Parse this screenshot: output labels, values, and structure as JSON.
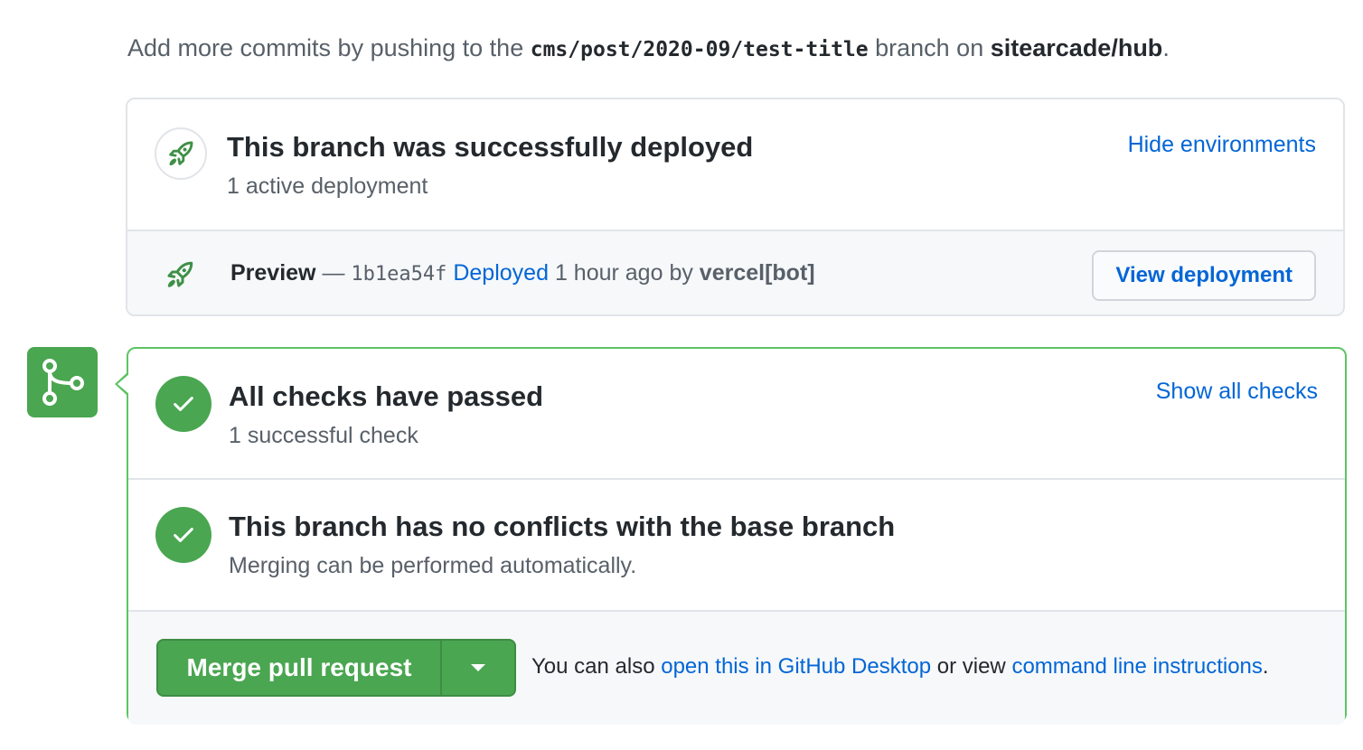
{
  "hint": {
    "prefix": "Add more commits by pushing to the",
    "branch": "cms/post/2020-09/test-title",
    "middle": "branch on",
    "repo": "sitearcade/hub",
    "suffix": "."
  },
  "deployment": {
    "title": "This branch was successfully deployed",
    "subtitle": "1 active deployment",
    "toggle_label": "Hide environments",
    "row": {
      "environment": "Preview",
      "separator": "—",
      "sha": "1b1ea54f",
      "status_link": "Deployed",
      "time": "1 hour ago",
      "by": "by",
      "author": "vercel[bot]",
      "button_label": "View deployment"
    }
  },
  "checks": {
    "title": "All checks have passed",
    "subtitle": "1 successful check",
    "toggle_label": "Show all checks"
  },
  "conflicts": {
    "title": "This branch has no conflicts with the base branch",
    "subtitle": "Merging can be performed automatically."
  },
  "merge": {
    "button_label": "Merge pull request",
    "note_prefix": "You can also",
    "desktop_link": "open this in GitHub Desktop",
    "note_middle": "or view",
    "cli_link": "command line instructions",
    "note_suffix": "."
  },
  "icons": {
    "rocket": "rocket-icon",
    "merge": "git-merge-icon",
    "check": "check-icon",
    "dropdown": "triangle-down-icon"
  },
  "colors": {
    "success": "#4aa651",
    "success_border": "#5ec466",
    "link": "#0366d6",
    "muted": "#586069"
  }
}
